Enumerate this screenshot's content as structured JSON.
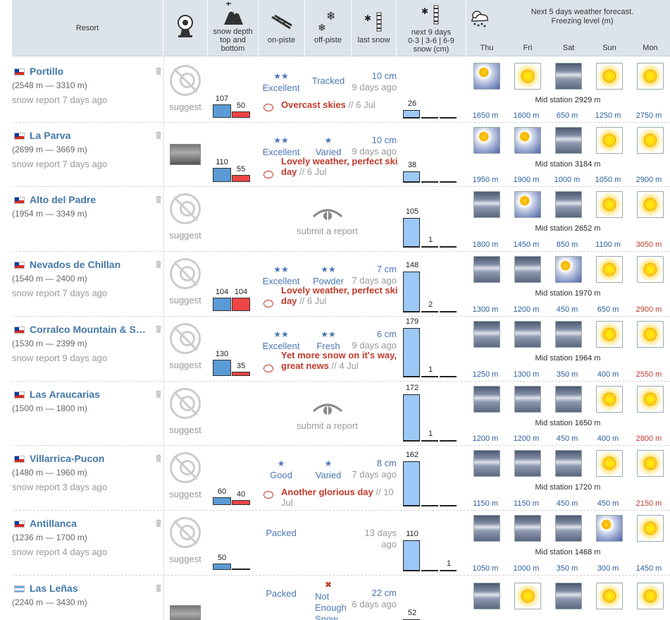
{
  "header": {
    "resort": "Resort",
    "snow_depth": "snow depth top and bottom",
    "on_piste": "on-piste",
    "off_piste": "off-piste",
    "last_snow": "last snow",
    "next9": "next 9 days",
    "next9_ranges": "0-3 | 3-6 | 6-9",
    "next9_unit": "snow (cm)",
    "forecast_title": "Next 5 days weather forecast.",
    "forecast_sub": "Freezing level (m)",
    "days": [
      "Thu",
      "Fri",
      "Sat",
      "Sun",
      "Mon"
    ]
  },
  "colors": {
    "accent": "#4378a8",
    "alert": "#c0392b",
    "header_bg": "#dde3eb"
  },
  "resorts": [
    {
      "name": "Portillo",
      "alt": "(2548 m — 3310 m)",
      "report": "snow report 7 days ago",
      "country": "cl",
      "webcam": "none",
      "cam_label": "suggest",
      "depth_top": "107",
      "depth_bottom": "50",
      "on_stars": "★★",
      "on_label": "Excellent",
      "off_stars": "",
      "off_label": "Tracked",
      "last_cm": "10 cm",
      "last_ago": "9 days ago",
      "comment": "Overcast skies",
      "comment_date": "// 6 Jul",
      "f1": "26",
      "f2": "",
      "f3": "",
      "wx": [
        "psun",
        "sun",
        "snow",
        "sun",
        "sun"
      ],
      "mid": "2929",
      "fl": [
        "1650 m",
        "1600 m",
        "650 m",
        "1250 m",
        "2750 m"
      ],
      "flc": [
        "b",
        "b",
        "b",
        "b",
        "b"
      ]
    },
    {
      "name": "La Parva",
      "alt": "(2699 m — 3669 m)",
      "report": "snow report 7 days ago",
      "country": "cl",
      "webcam": "image",
      "cam_label": "",
      "depth_top": "110",
      "depth_bottom": "55",
      "on_stars": "★★",
      "on_label": "Excellent",
      "off_stars": "★",
      "off_label": "Varied",
      "last_cm": "10 cm",
      "last_ago": "9 days ago",
      "comment": "Lovely weather, perfect ski day",
      "comment_date": "// 6 Jul",
      "f1": "38",
      "f2": "",
      "f3": "",
      "wx": [
        "psun",
        "psun",
        "snow",
        "sun",
        "sun"
      ],
      "mid": "3184",
      "fl": [
        "1950 m",
        "1900 m",
        "1000 m",
        "1050 m",
        "2900 m"
      ],
      "flc": [
        "b",
        "b",
        "b",
        "b",
        "b"
      ]
    },
    {
      "name": "Alto del Padre",
      "alt": "(1954 m — 3349 m)",
      "report": "",
      "country": "cl",
      "webcam": "none",
      "cam_label": "suggest",
      "depth_top": "",
      "depth_bottom": "",
      "on_stars": "",
      "on_label": "",
      "off_stars": "",
      "off_label": "",
      "last_cm": "",
      "last_ago": "",
      "comment": "",
      "comment_date": "",
      "submit": "submit a report",
      "f1": "105",
      "f2": "1",
      "f3": "",
      "wx": [
        "snow",
        "psun",
        "snow",
        "sun",
        "sun"
      ],
      "mid": "2652",
      "fl": [
        "1800 m",
        "1450 m",
        "850 m",
        "1100 m",
        "3050 m"
      ],
      "flc": [
        "b",
        "b",
        "b",
        "b",
        "r"
      ]
    },
    {
      "name": "Nevados de Chillan",
      "alt": "(1540 m — 2400 m)",
      "report": "snow report 7 days ago",
      "country": "cl",
      "webcam": "none",
      "cam_label": "suggest",
      "depth_top": "104",
      "depth_bottom": "104",
      "on_stars": "★★",
      "on_label": "Excellent",
      "off_stars": "★★",
      "off_label": "Powder",
      "last_cm": "7 cm",
      "last_ago": "7 days ago",
      "comment": "Lovely weather, perfect ski day",
      "comment_date": "// 6 Jul",
      "f1": "148",
      "f2": "2",
      "f3": "",
      "wx": [
        "snow",
        "snow",
        "psun",
        "sun",
        "sun"
      ],
      "mid": "1970",
      "fl": [
        "1300 m",
        "1200 m",
        "450 m",
        "650 m",
        "2900 m"
      ],
      "flc": [
        "b",
        "b",
        "b",
        "b",
        "r"
      ]
    },
    {
      "name": "Corralco Mountain & Ski …",
      "alt": "(1530 m — 2399 m)",
      "report": "snow report 9 days ago",
      "country": "cl",
      "webcam": "none",
      "cam_label": "suggest",
      "depth_top": "130",
      "depth_bottom": "35",
      "on_stars": "★★",
      "on_label": "Excellent",
      "off_stars": "★★",
      "off_label": "Fresh",
      "last_cm": "6 cm",
      "last_ago": "9 days ago",
      "comment": "Yet more snow on it's way, great news",
      "comment_date": "// 4 Jul",
      "f1": "179",
      "f2": "1",
      "f3": "",
      "wx": [
        "snow",
        "snow",
        "snow",
        "sun",
        "sun"
      ],
      "mid": "1964",
      "fl": [
        "1250 m",
        "1300 m",
        "350 m",
        "400 m",
        "2550 m"
      ],
      "flc": [
        "b",
        "b",
        "b",
        "b",
        "r"
      ]
    },
    {
      "name": "Las Araucarias",
      "alt": "(1500 m — 1800 m)",
      "report": "",
      "country": "cl",
      "webcam": "none",
      "cam_label": "suggest",
      "depth_top": "",
      "depth_bottom": "",
      "on_stars": "",
      "on_label": "",
      "off_stars": "",
      "off_label": "",
      "last_cm": "",
      "last_ago": "",
      "comment": "",
      "comment_date": "",
      "submit": "submit a report",
      "f1": "172",
      "f2": "1",
      "f3": "",
      "wx": [
        "snow",
        "snow",
        "snow",
        "sun",
        "sun"
      ],
      "mid": "1650",
      "fl": [
        "1200 m",
        "1200 m",
        "450 m",
        "400 m",
        "2800 m"
      ],
      "flc": [
        "b",
        "b",
        "b",
        "b",
        "r"
      ]
    },
    {
      "name": "Villarrica-Pucon",
      "alt": "(1480 m — 1960 m)",
      "report": "snow report 3 days ago",
      "country": "cl",
      "webcam": "none",
      "cam_label": "suggest",
      "depth_top": "60",
      "depth_bottom": "40",
      "on_stars": "★",
      "on_label": "Good",
      "off_stars": "★",
      "off_label": "Varied",
      "last_cm": "8 cm",
      "last_ago": "7 days ago",
      "comment": "Another glorious day",
      "comment_date": "// 10 Jul",
      "f1": "162",
      "f2": "",
      "f3": "",
      "wx": [
        "snow",
        "snow",
        "snow",
        "sun",
        "sun"
      ],
      "mid": "1720",
      "fl": [
        "1150 m",
        "1150 m",
        "450 m",
        "450 m",
        "2150 m"
      ],
      "flc": [
        "b",
        "b",
        "b",
        "b",
        "r"
      ]
    },
    {
      "name": "Antillanca",
      "alt": "(1236 m — 1700 m)",
      "report": "snow report 4 days ago",
      "country": "cl",
      "webcam": "none",
      "cam_label": "suggest",
      "depth_top": "50",
      "depth_bottom": "",
      "on_stars": "",
      "on_label": "Packed",
      "off_stars": "",
      "off_label": "",
      "last_cm": "",
      "last_ago": "13 days ago",
      "comment": "",
      "comment_date": "",
      "f1": "110",
      "f2": "",
      "f3": "1",
      "wx": [
        "snow",
        "snow",
        "snow",
        "psun",
        "sun"
      ],
      "mid": "1468",
      "fl": [
        "1050 m",
        "1000 m",
        "350 m",
        "300 m",
        "1450 m"
      ],
      "flc": [
        "b",
        "b",
        "b",
        "b",
        "b"
      ]
    },
    {
      "name": "Las Leñas",
      "alt": "(2240 m — 3430 m)",
      "report": "",
      "country": "ar",
      "webcam": "image",
      "cam_label": "",
      "depth_top": "",
      "depth_bottom": "",
      "on_stars": "",
      "on_label": "Packed",
      "off_stars": "✖",
      "off_label": "Not Enough Snow",
      "last_cm": "22 cm",
      "last_ago": "6 days ago",
      "comment": "",
      "comment_date": "",
      "f1": "52",
      "f2": "",
      "f3": "",
      "wx": [
        "snow",
        "sun",
        "snow",
        "sun",
        "sun"
      ],
      "mid": "",
      "fl": [
        "",
        "",
        "",
        "",
        ""
      ],
      "flc": [
        "b",
        "b",
        "b",
        "b",
        "b"
      ]
    }
  ]
}
